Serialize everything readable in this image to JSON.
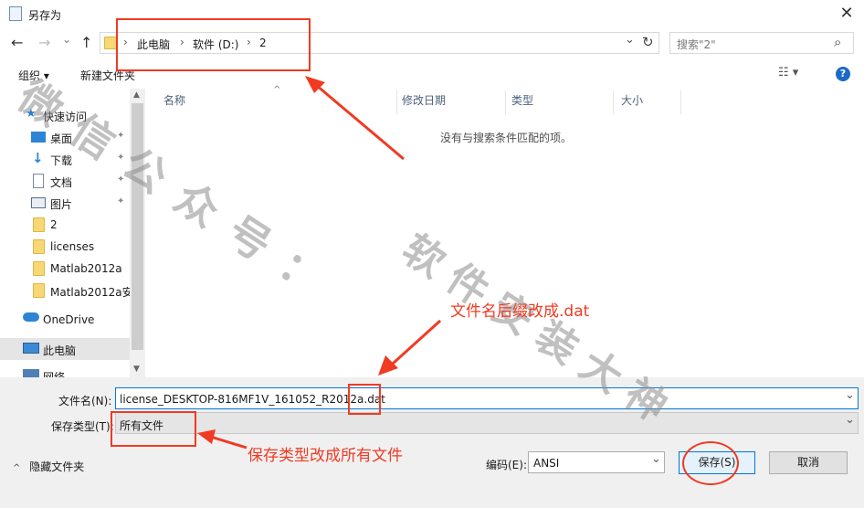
{
  "window": {
    "title": "另存为",
    "close_glyph": "✕"
  },
  "nav": {
    "back": "←",
    "forward": "→",
    "up": "↑",
    "refresh": "↻",
    "dropdown": "⌄"
  },
  "address": {
    "parts": [
      "此电脑",
      "软件 (D:)",
      "2"
    ],
    "separator": "›"
  },
  "search": {
    "placeholder": "搜索\"2\"",
    "icon": "⌕"
  },
  "toolbar": {
    "organize": "组织 ▾",
    "new_folder": "新建文件夹",
    "view": "☷ ▾",
    "help": "?"
  },
  "sidebar": {
    "items": [
      {
        "label": "快速访问",
        "icon": "star-icon"
      },
      {
        "label": "桌面",
        "icon": "desktop-icon"
      },
      {
        "label": "下载",
        "icon": "download-icon"
      },
      {
        "label": "文档",
        "icon": "document-icon"
      },
      {
        "label": "图片",
        "icon": "picture-icon"
      },
      {
        "label": "2",
        "icon": "folder-icon"
      },
      {
        "label": "licenses",
        "icon": "folder-icon"
      },
      {
        "label": "Matlab2012a",
        "icon": "folder-icon"
      },
      {
        "label": "Matlab2012a安",
        "icon": "folder-icon"
      },
      {
        "label": "OneDrive",
        "icon": "cloud-icon"
      },
      {
        "label": "此电脑",
        "icon": "computer-icon"
      },
      {
        "label": "网络",
        "icon": "network-icon"
      }
    ],
    "pin_glyph": "📌"
  },
  "columns": [
    "名称",
    "修改日期",
    "类型",
    "大小"
  ],
  "empty_message": "没有与搜索条件匹配的项。",
  "form": {
    "filename_label": "文件名(N):",
    "filename_value": "license_DESKTOP-816MF1V_161052_R2012a.dat",
    "filetype_label": "保存类型(T):",
    "filetype_value": "所有文件",
    "encoding_label": "编码(E):",
    "encoding_value": "ANSI",
    "hide_folders": "隐藏文件夹",
    "save_button": "保存(S)",
    "cancel_button": "取消"
  },
  "annotations": {
    "suffix_note": "文件名后缀改成.dat",
    "type_note": "保存类型改成所有文件"
  },
  "watermark": {
    "line1": "微信公众号：",
    "line2": "软件安装大神"
  },
  "colors": {
    "annotation_red": "#f13a22",
    "accent_blue": "#0078d7",
    "folder_yellow": "#f8d775"
  }
}
